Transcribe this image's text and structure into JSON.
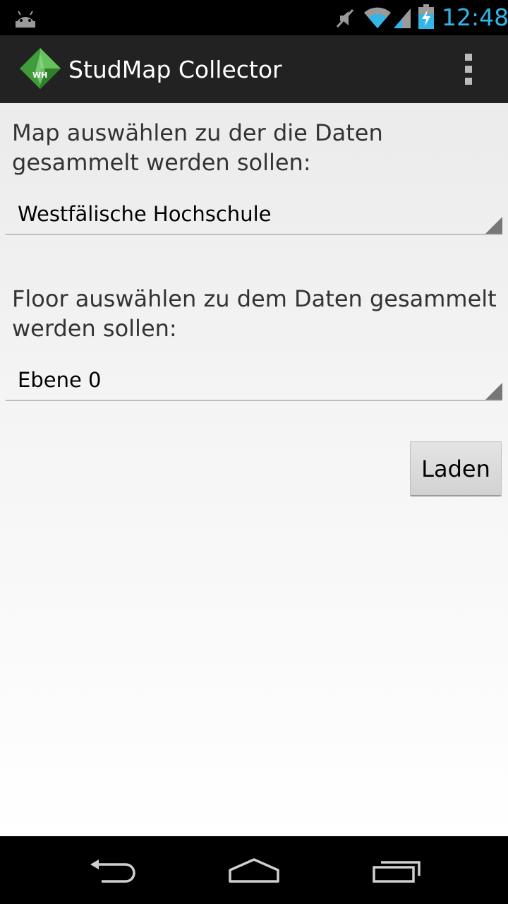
{
  "status_bar": {
    "time": "12:48",
    "time_color": "#33b5e5",
    "icons": [
      "android-icon",
      "mute-icon",
      "wifi-icon",
      "signal-icon",
      "battery-charging-icon"
    ]
  },
  "action_bar": {
    "title": "StudMap Collector",
    "logo": "wh-logo-icon",
    "overflow": "overflow-menu-icon",
    "background": "#222222"
  },
  "form": {
    "map_label": "Map auswählen zu der die Daten gesammelt werden sollen:",
    "map_selected": "Westfälische Hochschule",
    "floor_label": "Floor auswählen zu dem Daten gesammelt werden sollen:",
    "floor_selected": "Ebene 0",
    "load_button": "Laden"
  },
  "nav_bar": {
    "icons": [
      "back-icon",
      "home-icon",
      "recents-icon"
    ]
  }
}
